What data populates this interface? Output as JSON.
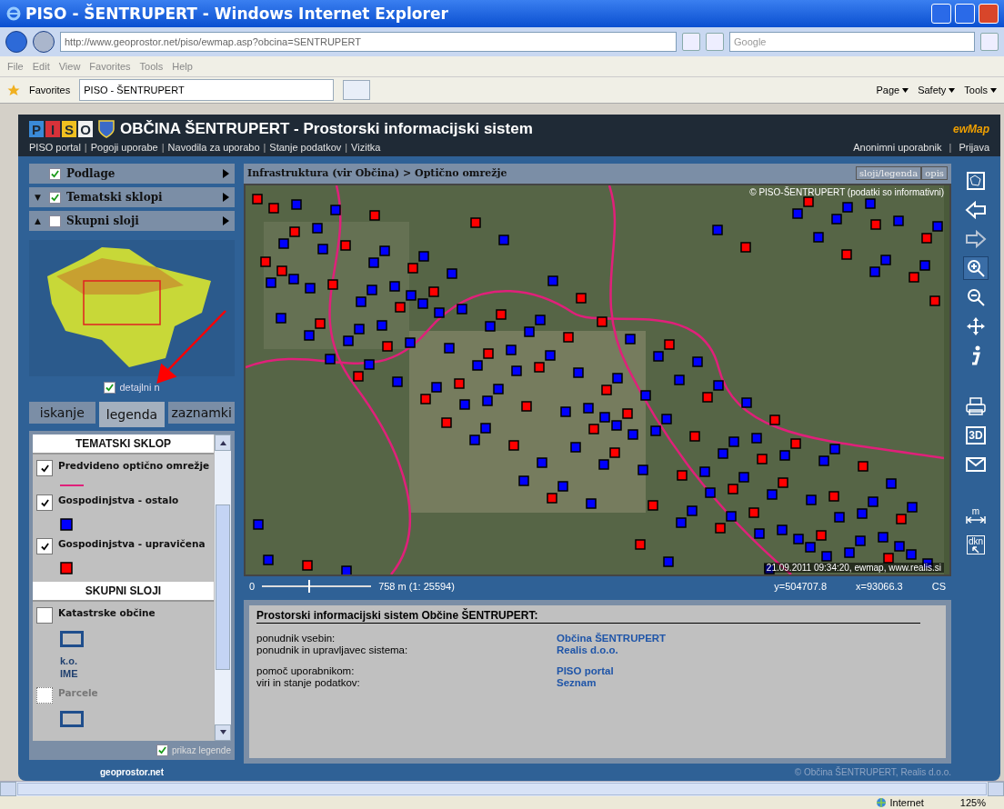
{
  "window": {
    "title": "PISO - ŠENTRUPERT - Windows Internet Explorer"
  },
  "address_bar": {
    "url": "http://www.geoprostor.net/piso/ewmap.asp?obcina=SENTRUPERT",
    "search_placeholder": "Google"
  },
  "menu": [
    "File",
    "Edit",
    "View",
    "Favorites",
    "Tools",
    "Help"
  ],
  "favorites_bar": {
    "favorites": "Favorites",
    "tab": "PISO - ŠENTRUPERT",
    "commands": [
      "Page",
      "Safety",
      "Tools"
    ]
  },
  "app": {
    "logo_letters": [
      "P",
      "I",
      "S",
      "O"
    ],
    "title": "OBČINA ŠENTRUPERT - Prostorski informacijski sistem",
    "brand": "ewMap",
    "nav_links": [
      "PISO portal",
      "Pogoji uporabe",
      "Navodila za uporabo",
      "Stanje podatkov",
      "Vizitka"
    ],
    "user_links": [
      "Anonimni uporabnik",
      "Prijava"
    ],
    "link_separator": "|"
  },
  "layer_groups": [
    {
      "label": "Podlage",
      "checked": true
    },
    {
      "label": "Tematski sklopi",
      "checked": true,
      "toggle": "▼"
    },
    {
      "label": "Skupni sloji",
      "checked": false,
      "toggle": "▲"
    }
  ],
  "overview": {
    "detail_label": "detajlni n",
    "detail_checked": true
  },
  "tabs": [
    {
      "label": "iskanje",
      "selected": false
    },
    {
      "label": "legenda",
      "selected": true
    },
    {
      "label": "zaznamki",
      "selected": false
    }
  ],
  "legend": {
    "sections": [
      {
        "title": "TEMATSKI SKLOP",
        "items": [
          {
            "label": "Predvideno optično omrežje",
            "checked": true,
            "disabled": false,
            "kind": "line",
            "color": "#e0207a"
          },
          {
            "label": "Gospodinjstva - ostalo",
            "checked": true,
            "disabled": false,
            "kind": "square",
            "color": "#0000ff"
          },
          {
            "label": "Gospodinjstva - upravičena",
            "checked": true,
            "disabled": false,
            "kind": "square",
            "color": "#ff0000"
          }
        ]
      },
      {
        "title": "SKUPNI SLOJI",
        "items": [
          {
            "label": "Katastrske občine",
            "checked": false,
            "disabled": false,
            "kind": "outline",
            "color": "#1f4e8c",
            "caption": [
              "k.o.",
              "IME"
            ]
          },
          {
            "label": "Parcele",
            "checked": false,
            "disabled": true,
            "kind": "outline",
            "color": "#1f4e8c"
          }
        ]
      }
    ],
    "show_legend_label": "prikaz legende",
    "show_legend_checked": true
  },
  "footer_logo": "geoprostor.net",
  "map": {
    "breadcrumb": "Infrastruktura (vir Občina) > Optično omrežje",
    "buttons": [
      "sloji/legenda",
      "opis"
    ],
    "copyright": "© PISO-ŠENTRUPERT (podatki so informativni)",
    "timestamp": "21.09.2011 09:34:20, ewmap, www.realis.si"
  },
  "scale": {
    "zero": "0",
    "level": 0.42,
    "reading": "758 m (1: 25594)"
  },
  "coords": {
    "y": "y=504707.8",
    "x": "x=93066.3",
    "crs": "CS"
  },
  "info": {
    "title": "Prostorski informacijski sistem Občine ŠENTRUPERT:",
    "groups": [
      [
        {
          "label": "ponudnik vsebin:",
          "value": "Občina ŠENTRUPERT"
        },
        {
          "label": "ponudnik in upravljavec sistema:",
          "value": "Realis d.o.o."
        }
      ],
      [
        {
          "label": "pomoč uporabnikom:",
          "value": "PISO portal"
        },
        {
          "label": "viri in stanje podatkov:",
          "value": "Seznam"
        }
      ]
    ]
  },
  "copyright": "© Občina ŠENTRUPERT, Realis d.o.o.",
  "toolbar": [
    {
      "kind": "overview",
      "selected": false,
      "disabled": false
    },
    {
      "kind": "back",
      "selected": false,
      "disabled": false
    },
    {
      "kind": "forward",
      "selected": false,
      "disabled": true
    },
    {
      "kind": "zoom-in",
      "selected": true,
      "disabled": false
    },
    {
      "kind": "zoom-out",
      "selected": false,
      "disabled": false
    },
    {
      "kind": "pan",
      "selected": false,
      "disabled": false
    },
    {
      "kind": "info",
      "selected": false,
      "disabled": false
    },
    {
      "kind": "gap"
    },
    {
      "kind": "print",
      "selected": false,
      "disabled": false
    },
    {
      "kind": "cube",
      "label": "3D",
      "selected": false,
      "disabled": false
    },
    {
      "kind": "mail",
      "selected": false,
      "disabled": false
    },
    {
      "kind": "gap"
    },
    {
      "kind": "measure",
      "label": "m",
      "selected": false,
      "disabled": false
    },
    {
      "kind": "dkn",
      "label": "dkn",
      "selected": false,
      "disabled": false
    }
  ],
  "status_bar": {
    "zone": "Internet",
    "zoom": "125%"
  }
}
